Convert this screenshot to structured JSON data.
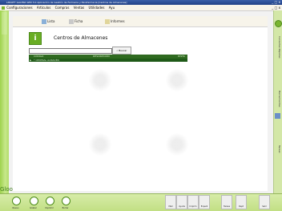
{
  "window": {
    "title": "LNSOFT GALERA WIN 3.0  Aplicación de Gestión de Farmacia y Parafarmacia  [Centros de Almacenes]",
    "controls": [
      "_",
      "□",
      "x"
    ]
  },
  "menubar": {
    "items": [
      "Configuraciones",
      "Artículos",
      "Compras",
      "Ventas",
      "Utilidades",
      "Ayu"
    ]
  },
  "toolbar": {
    "buttons": [
      "Lista",
      "Ficha",
      "Informes"
    ]
  },
  "page": {
    "title": "Centros de Almacenes",
    "search_placeholder": "",
    "search_button": "Buscar",
    "grid": {
      "columns": [
        "CÓDIGO",
        "DESCRIPCIÓN",
        "DISTA"
      ],
      "rows": [
        {
          "marker": "▶",
          "text": "* CENTRAL ALMACÉN"
        }
      ]
    }
  },
  "brand": {
    "name": "Gloo"
  },
  "rightstrip": {
    "tabs": [
      "Consultas Rápidas",
      "Herramientas",
      "Tareas"
    ]
  },
  "bottombar": {
    "left_buttons": [
      "Nuevo",
      "Grabar",
      "Imprimir",
      "Borrar"
    ],
    "right_buttons": [
      "Mail",
      "Ayuda",
      "Imprim",
      "Expedi",
      "Tareas",
      "Dept",
      "Salir"
    ]
  },
  "colors": {
    "accent_green": "#7ab530",
    "grid_header": "#2f6a20",
    "title_blue": "#2a4d96"
  }
}
